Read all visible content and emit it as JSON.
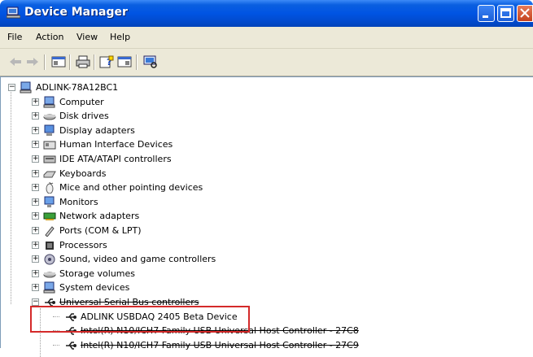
{
  "window": {
    "title": "Device Manager"
  },
  "menu": [
    "File",
    "Action",
    "View",
    "Help"
  ],
  "toolbar": {
    "icons": [
      "back-arrow-icon",
      "forward-arrow-icon",
      "show-hide-console-tree-icon",
      "print-icon",
      "properties-help-icon",
      "view-icon",
      "scan-hardware-icon"
    ]
  },
  "tree": {
    "root": "ADLINK-78A12BC1",
    "categories": [
      {
        "label": "Computer",
        "icon": "computer-icon"
      },
      {
        "label": "Disk drives",
        "icon": "disk-drive-icon"
      },
      {
        "label": "Display adapters",
        "icon": "display-adapter-icon"
      },
      {
        "label": "Human Interface Devices",
        "icon": "hid-icon"
      },
      {
        "label": "IDE ATA/ATAPI controllers",
        "icon": "ide-controller-icon"
      },
      {
        "label": "Keyboards",
        "icon": "keyboard-icon"
      },
      {
        "label": "Mice and other pointing devices",
        "icon": "mouse-icon"
      },
      {
        "label": "Monitors",
        "icon": "monitor-icon"
      },
      {
        "label": "Network adapters",
        "icon": "network-adapter-icon"
      },
      {
        "label": "Ports (COM & LPT)",
        "icon": "port-icon"
      },
      {
        "label": "Processors",
        "icon": "processor-icon"
      },
      {
        "label": "Sound, video and game controllers",
        "icon": "sound-icon"
      },
      {
        "label": "Storage volumes",
        "icon": "storage-volume-icon"
      },
      {
        "label": "System devices",
        "icon": "system-devices-icon"
      },
      {
        "label": "Universal Serial Bus controllers",
        "icon": "usb-icon"
      }
    ],
    "usb_children": [
      "ADLINK USBDAQ 2405 Beta Device",
      "Intel(R) N10/ICH7 Family USB Universal Host Controller - 27C8",
      "Intel(R) N10/ICH7 Family USB Universal Host Controller - 27C9"
    ]
  },
  "colors": {
    "highlight_border": "#d42a2a",
    "title_bar": "#0054e3",
    "menu_bg": "#ece9d8"
  }
}
